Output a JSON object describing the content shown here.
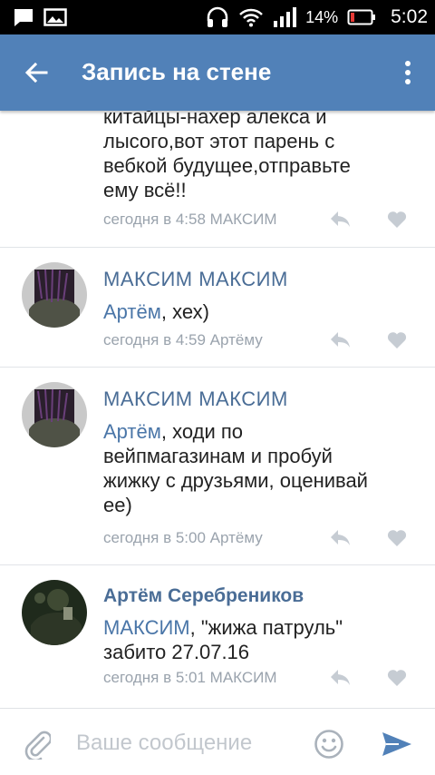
{
  "status_bar": {
    "battery_percent": "14%",
    "time": "5:02",
    "icons": [
      "message-icon",
      "image-icon",
      "headphones-icon",
      "wifi-icon",
      "signal-icon",
      "battery-icon"
    ]
  },
  "header": {
    "title": "Запись на стене",
    "back_icon": "arrow-left-icon",
    "more_icon": "vertical-dots-icon",
    "color": "#5181b8"
  },
  "comments": [
    {
      "author": "",
      "lines": [
        "китайцы-нахер алекса и",
        "лысого,вот этот парень с",
        "вебкой будущее,отправьте",
        "ему всё!!"
      ],
      "meta": "сегодня в 4:58 МАКСИМ"
    },
    {
      "author": "МАКСИМ МАКСИМ",
      "mention": "Артём",
      "text": ", хех)",
      "meta": "сегодня в 4:59 Артёму"
    },
    {
      "author": "МАКСИМ МАКСИМ",
      "mention": "Артём",
      "text_line1": ", ходи по",
      "lines": [
        "вейпмагазинам и пробуй",
        "жижку с друзьями, оценивай",
        "ее)"
      ],
      "meta": "сегодня в 5:00 Артёму"
    },
    {
      "author": "Артём Серебреников",
      "mention": "МАКСИМ",
      "text_line1": ", \"жижа патруль\"",
      "line2": "забито 27.07.16",
      "meta": "сегодня в 5:01 МАКСИМ"
    }
  ],
  "composer": {
    "placeholder": "Ваше сообщение",
    "attach_icon": "paperclip-icon",
    "emoji_icon": "smiley-icon",
    "send_icon": "send-icon"
  },
  "colors": {
    "link": "#4a6d96",
    "meta": "#9aa3ad",
    "send": "#5181b8"
  }
}
